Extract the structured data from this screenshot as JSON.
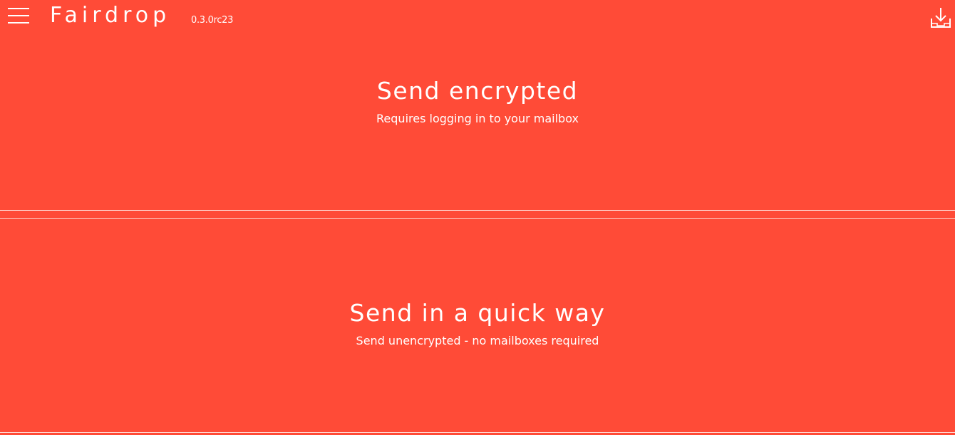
{
  "header": {
    "menu_icon": "hamburger-menu-icon",
    "logo": "Fairdrop",
    "version": "0.3.0rc23",
    "download_icon": "download-inbox-icon"
  },
  "sections": [
    {
      "title": "Send encrypted",
      "subtitle": "Requires logging in to your mailbox"
    },
    {
      "title": "Send in a quick way",
      "subtitle": "Send unencrypted - no mailboxes required"
    }
  ],
  "colors": {
    "background": "#ff4b37",
    "foreground": "#ffffff",
    "divider": "#ffd6d0"
  }
}
